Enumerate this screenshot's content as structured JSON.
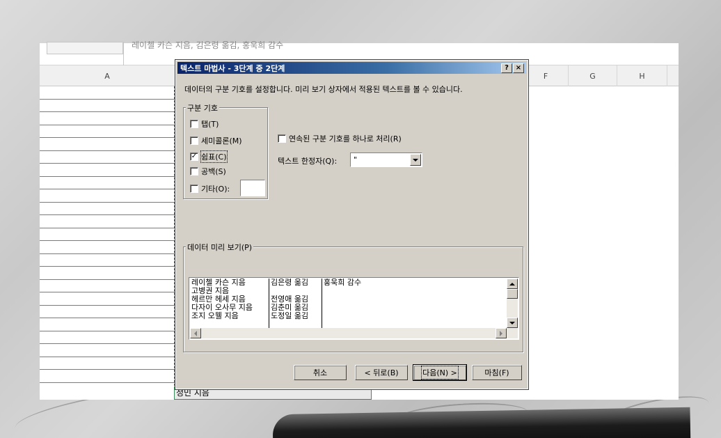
{
  "excel": {
    "formula_text": "레이첼 카슨 지음, 김은령 옮김, 홍욱희 감수",
    "col_headers": [
      "A",
      "F",
      "G",
      "H"
    ],
    "peek_cell": "정민 지음"
  },
  "dialog": {
    "title": "텍스트 마법사 - 3단계 중 2단계",
    "help_btn": "?",
    "close_btn": "×",
    "description": "데이터의 구분 기호를 설정합니다. 미리 보기 상자에서 적용된 텍스트를 볼 수 있습니다.",
    "delimiters": {
      "label": "구분 기호",
      "tab": {
        "label": "탭(T)",
        "checked": false
      },
      "semicolon": {
        "label": "세미콜론(M)",
        "checked": false
      },
      "comma": {
        "label": "쉼표(C)",
        "checked": true
      },
      "space": {
        "label": "공백(S)",
        "checked": false
      },
      "other": {
        "label": "기타(O):",
        "checked": false,
        "value": ""
      }
    },
    "consecutive": {
      "label": "연속된 구분 기호를 하나로 처리(R)",
      "checked": false
    },
    "qualifier": {
      "label": "텍스트 한정자(Q):",
      "value": "\""
    },
    "preview": {
      "label": "데이터 미리 보기(P)",
      "rows": [
        [
          "레이첼 카슨 지음",
          "김은령 옮김",
          "홍욱희 감수"
        ],
        [
          "고병권 지음",
          "",
          ""
        ],
        [
          "헤르만 헤세 지음",
          "전영애 옮김",
          ""
        ],
        [
          "다자이 오사무 지음",
          "김춘미 옮김",
          ""
        ],
        [
          "조지 오웰 지음",
          "도정일 옮김",
          ""
        ]
      ]
    },
    "buttons": {
      "cancel": "취소",
      "back": "< 뒤로(B)",
      "next": "다음(N) >",
      "finish": "마침(F)"
    }
  }
}
